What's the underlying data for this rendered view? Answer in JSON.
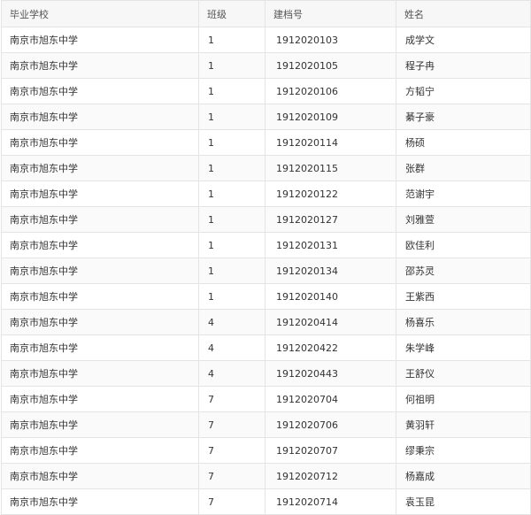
{
  "table": {
    "headers": [
      "毕业学校",
      "班级",
      "建档号",
      "姓名"
    ],
    "rows": [
      [
        "南京市旭东中学",
        "1",
        "1912020103",
        "成学文"
      ],
      [
        "南京市旭东中学",
        "1",
        "1912020105",
        "程子冉"
      ],
      [
        "南京市旭东中学",
        "1",
        "1912020106",
        "方韬宁"
      ],
      [
        "南京市旭东中学",
        "1",
        "1912020109",
        "綦子豪"
      ],
      [
        "南京市旭东中学",
        "1",
        "1912020114",
        "杨硕"
      ],
      [
        "南京市旭东中学",
        "1",
        "1912020115",
        "张群"
      ],
      [
        "南京市旭东中学",
        "1",
        "1912020122",
        "范谢宇"
      ],
      [
        "南京市旭东中学",
        "1",
        "1912020127",
        "刘雅萱"
      ],
      [
        "南京市旭东中学",
        "1",
        "1912020131",
        "欧佳利"
      ],
      [
        "南京市旭东中学",
        "1",
        "1912020134",
        "邵苏灵"
      ],
      [
        "南京市旭东中学",
        "1",
        "1912020140",
        "王紫西"
      ],
      [
        "南京市旭东中学",
        "4",
        "1912020414",
        "杨喜乐"
      ],
      [
        "南京市旭东中学",
        "4",
        "1912020422",
        "朱学峰"
      ],
      [
        "南京市旭东中学",
        "4",
        "1912020443",
        "王舒仪"
      ],
      [
        "南京市旭东中学",
        "7",
        "1912020704",
        "何祖明"
      ],
      [
        "南京市旭东中学",
        "7",
        "1912020706",
        "黄羽轩"
      ],
      [
        "南京市旭东中学",
        "7",
        "1912020707",
        "缪秉宗"
      ],
      [
        "南京市旭东中学",
        "7",
        "1912020712",
        "杨嘉成"
      ],
      [
        "南京市旭东中学",
        "7",
        "1912020714",
        "袁玉昆"
      ]
    ]
  }
}
